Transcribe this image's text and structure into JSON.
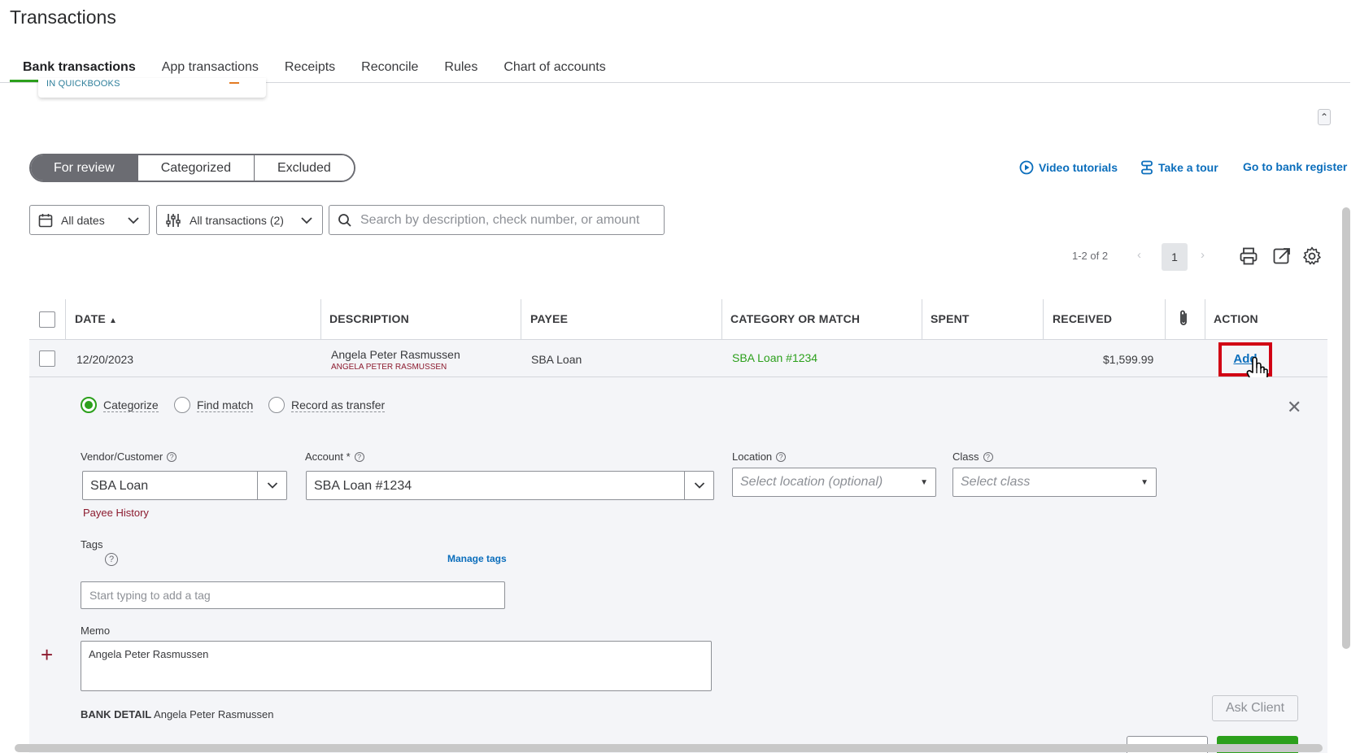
{
  "page": {
    "title": "Transactions"
  },
  "tabs": [
    {
      "label": "Bank transactions",
      "active": true
    },
    {
      "label": "App transactions"
    },
    {
      "label": "Receipts"
    },
    {
      "label": "Reconcile"
    },
    {
      "label": "Rules"
    },
    {
      "label": "Chart of accounts"
    }
  ],
  "account_card": {
    "label": "IN QUICKBOOKS"
  },
  "review_tabs": [
    {
      "label": "For review",
      "active": true
    },
    {
      "label": "Categorized"
    },
    {
      "label": "Excluded"
    }
  ],
  "links": {
    "video_tutorials": "Video tutorials",
    "take_a_tour": "Take a tour",
    "bank_register": "Go to bank register"
  },
  "filters": {
    "dates": "All dates",
    "transactions": "All transactions (2)",
    "search_placeholder": "Search by description, check number, or amount"
  },
  "pager": {
    "range": "1-2 of 2",
    "current_page": "1",
    "prev": "‹",
    "next": "›"
  },
  "table": {
    "headers": {
      "date": "DATE",
      "sort_indicator": "▲",
      "description": "DESCRIPTION",
      "payee": "PAYEE",
      "category": "CATEGORY OR MATCH",
      "spent": "SPENT",
      "received": "RECEIVED",
      "action": "ACTION"
    },
    "row": {
      "date": "12/20/2023",
      "description": "Angela Peter Rasmussen",
      "description_sub": "ANGELA PETER RASMUSSEN",
      "payee": "SBA Loan",
      "category": "SBA Loan #1234",
      "spent": "",
      "received": "$1,599.99",
      "action": "Add"
    }
  },
  "detail": {
    "radio_categorize": "Categorize",
    "radio_find_match": "Find match",
    "radio_transfer": "Record as transfer",
    "vendor_label": "Vendor/Customer",
    "vendor_value": "SBA Loan",
    "payee_history": "Payee History",
    "account_label": "Account *",
    "account_value": "SBA Loan #1234",
    "location_label": "Location",
    "location_placeholder": "Select location (optional)",
    "class_label": "Class",
    "class_placeholder": "Select class",
    "tags_label": "Tags",
    "tags_help": "?",
    "manage_tags": "Manage tags",
    "tags_placeholder": "Start typing to add a tag",
    "memo_label": "Memo",
    "memo_value": "Angela Peter Rasmussen",
    "bank_detail_label": "BANK DETAIL",
    "bank_detail_value": "Angela Peter Rasmussen",
    "ask_client": "Ask Client",
    "plus": "+",
    "close": "✕"
  },
  "colors": {
    "accent_green": "#2ca01c",
    "link_blue": "#0b6ebc",
    "highlight_red": "#d10014"
  },
  "icons": [
    "calendar-icon",
    "chevron-down-icon",
    "filter-sliders-icon",
    "search-icon",
    "play-circle-icon",
    "tour-icon",
    "print-icon",
    "export-icon",
    "gear-icon",
    "paperclip-icon",
    "hand-cursor-icon",
    "close-icon",
    "help-icon",
    "plus-icon"
  ]
}
